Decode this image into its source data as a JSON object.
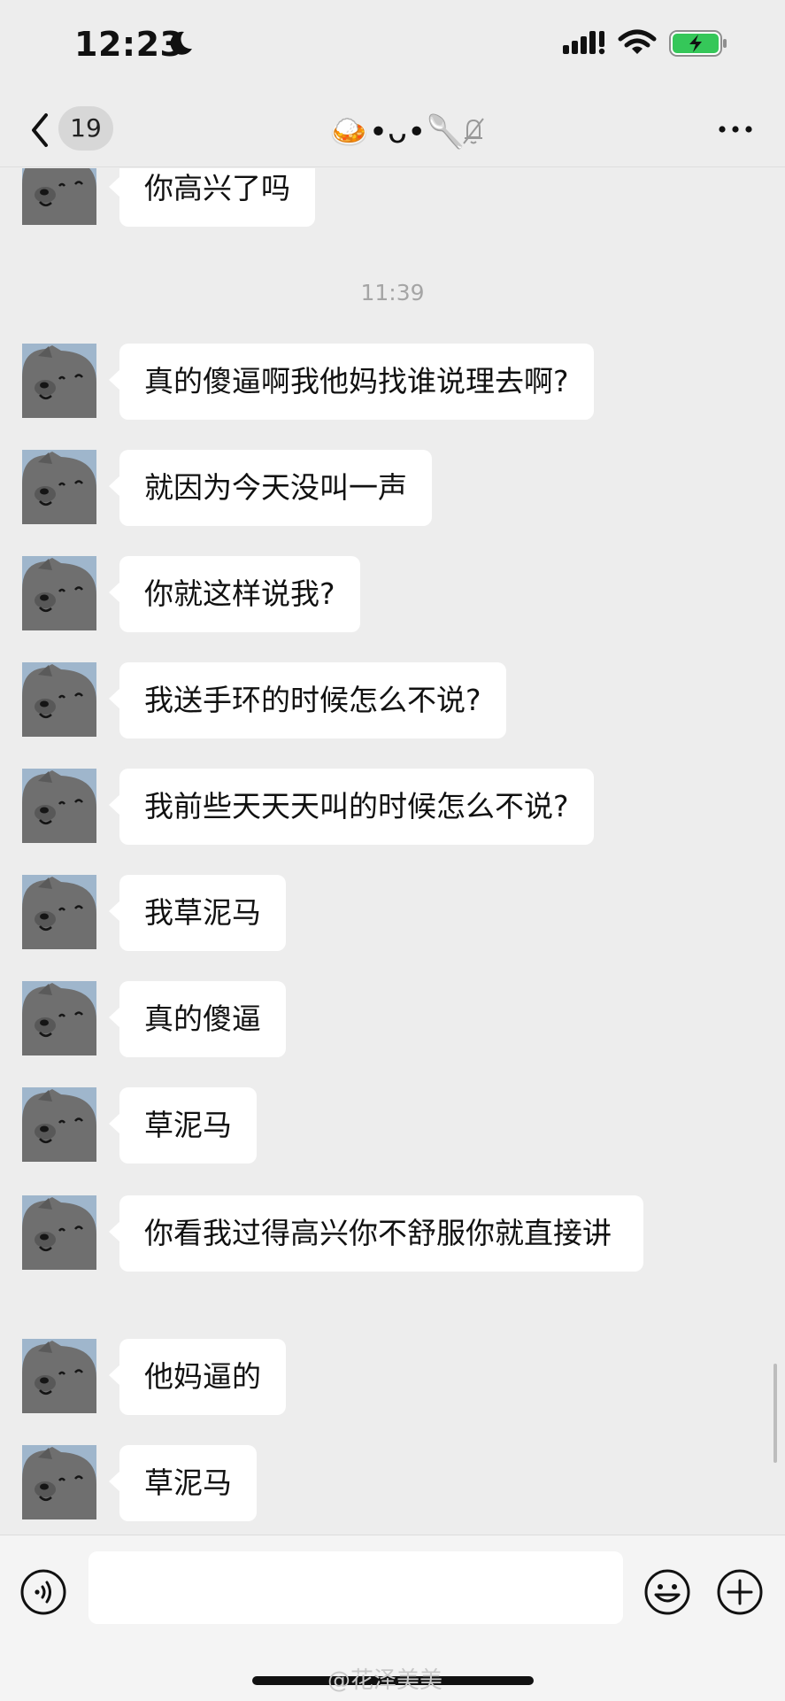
{
  "status_bar": {
    "time": "12:23",
    "moon_icon": "moon-icon",
    "signal_icon": "signal-icon",
    "wifi_icon": "wifi-icon",
    "battery_icon": "battery-charging-icon"
  },
  "nav": {
    "unread_count": "19",
    "title": "🍛•ᴗ•🥄",
    "back_icon": "chevron-left-icon",
    "muted_icon": "bell-off-icon",
    "more_icon": "more-icon"
  },
  "chat": {
    "timestamp": "11:39",
    "messages": [
      "你高兴了吗",
      "真的傻逼啊我他妈找谁说理去啊?",
      "就因为今天没叫一声",
      "你就这样说我?",
      "我送手环的时候怎么不说?",
      "我前些天天天叫的时候怎么不说?",
      "我草泥马",
      "真的傻逼",
      "草泥马",
      "你看我过得高兴你不舒服你就直接讲",
      "他妈逼的",
      "草泥马"
    ]
  },
  "input_bar": {
    "voice_icon": "voice-icon",
    "emoji_icon": "emoji-icon",
    "add_icon": "plus-circle-icon",
    "message_value": ""
  },
  "watermark": "@花泽美美",
  "colors": {
    "background": "#ededed",
    "bubble": "#ffffff",
    "battery_green": "#35c759"
  }
}
